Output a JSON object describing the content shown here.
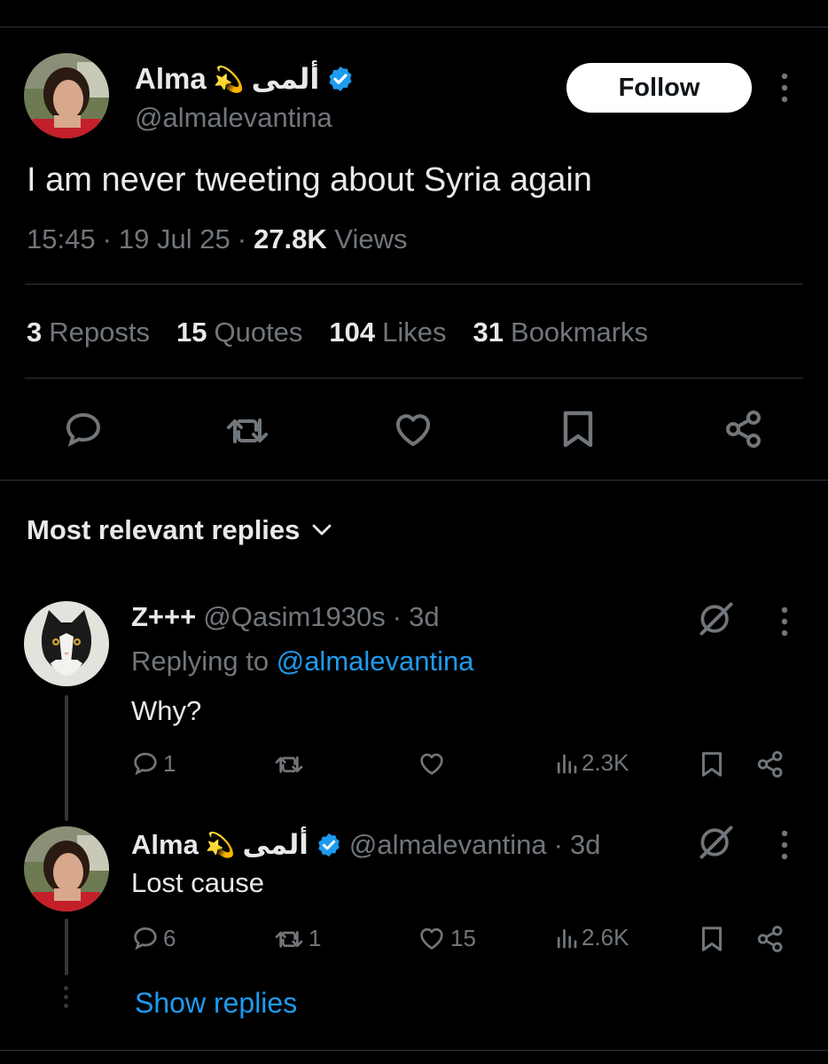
{
  "tweet": {
    "author_name": "Alma",
    "author_emoji": "💫",
    "author_arabic": "ألمى",
    "author_handle": "@almalevantina",
    "follow_label": "Follow",
    "text": "I am never tweeting about Syria again",
    "time": "15:45",
    "date": "19 Jul 25",
    "views_count": "27.8K",
    "views_label": "Views",
    "stats": {
      "reposts_count": "3",
      "reposts_label": "Reposts",
      "quotes_count": "15",
      "quotes_label": "Quotes",
      "likes_count": "104",
      "likes_label": "Likes",
      "bookmarks_count": "31",
      "bookmarks_label": "Bookmarks"
    }
  },
  "replies_section": {
    "title": "Most relevant replies"
  },
  "replies": [
    {
      "name": "Z+++",
      "handle": "@Qasim1930s",
      "age": "3d",
      "replying_prefix": "Replying to",
      "replying_handle": "@almalevantina",
      "text": "Why?",
      "reply_count": "1",
      "repost_count": "",
      "like_count": "",
      "views": "2.3K"
    },
    {
      "name": "Alma",
      "emoji": "💫",
      "arabic": "ألمى",
      "handle": "@almalevantina",
      "age": "3d",
      "text": "Lost cause",
      "reply_count": "6",
      "repost_count": "1",
      "like_count": "15",
      "views": "2.6K"
    }
  ],
  "show_replies_label": "Show replies",
  "colors": {
    "background": "#000000",
    "text": "#e7e9ea",
    "secondary": "#71767b",
    "accent": "#1d9bf0",
    "divider": "#2f3336"
  },
  "icons": [
    "more-icon",
    "verified-icon",
    "reply-icon",
    "repost-icon",
    "like-icon",
    "bookmark-icon",
    "share-icon",
    "chevron-down-icon",
    "grok-icon",
    "views-icon"
  ]
}
